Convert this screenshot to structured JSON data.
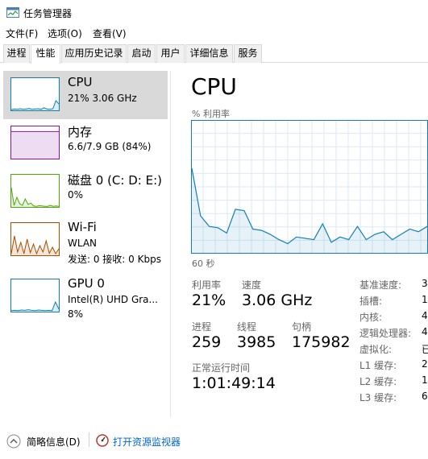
{
  "window": {
    "title": "任务管理器"
  },
  "menu": [
    "文件(F)",
    "选项(O)",
    "查看(V)"
  ],
  "tabs": [
    "进程",
    "性能",
    "应用历史记录",
    "启动",
    "用户",
    "详细信息",
    "服务"
  ],
  "active_tab": "性能",
  "resources": [
    {
      "name": "CPU",
      "line2": "21%  3.06 GHz",
      "line3": "",
      "color": "#117dbb",
      "selected": true,
      "values": [
        2,
        4,
        3,
        5,
        3,
        4,
        6,
        3,
        4,
        5,
        3,
        8,
        4,
        3,
        5,
        30,
        20
      ]
    },
    {
      "name": "内存",
      "line2": "6.6/7.9 GB (84%)",
      "line3": "",
      "color": "#8b12ae",
      "selected": false,
      "values": [
        84,
        84,
        84,
        84,
        84,
        84,
        84,
        84,
        84,
        84,
        84
      ]
    },
    {
      "name": "磁盘 0 (C: D: E:)",
      "line2": "0%",
      "line3": "",
      "color": "#4da60c",
      "selected": false,
      "values": [
        60,
        5,
        30,
        10,
        5,
        25,
        8,
        12,
        3,
        2,
        4,
        3,
        2,
        2,
        5,
        2,
        3,
        2
      ]
    },
    {
      "name": "Wi-Fi",
      "line2": "WLAN",
      "line3": "发送: 0 接收: 0 Kbps",
      "color": "#a74f01",
      "selected": false,
      "values": [
        5,
        60,
        10,
        40,
        5,
        50,
        8,
        35,
        5,
        30,
        10,
        45,
        6,
        25,
        5,
        20
      ]
    },
    {
      "name": "GPU 0",
      "line2": "Intel(R) UHD Gra...",
      "line3": "8%",
      "color": "#117dbb",
      "selected": false,
      "values": [
        3,
        4,
        3,
        5,
        4,
        6,
        4,
        3,
        5,
        4,
        3,
        4,
        3,
        30,
        8
      ]
    }
  ],
  "main": {
    "title": "CPU",
    "chart_label": "% 利用率",
    "time_label": "60 秒",
    "cpu_history": [
      64,
      28,
      20,
      19,
      15,
      33,
      32,
      18,
      17,
      14,
      10,
      7,
      12,
      11,
      10,
      22,
      8,
      12,
      10,
      20,
      10,
      14,
      16,
      10,
      14,
      18,
      16,
      20
    ]
  },
  "stats": {
    "util_label": "利用率",
    "util_value": "21%",
    "speed_label": "速度",
    "speed_value": "3.06 GHz",
    "proc_label": "进程",
    "proc_value": "259",
    "thread_label": "线程",
    "thread_value": "3985",
    "handle_label": "句柄",
    "handle_value": "175982",
    "uptime_label": "正常运行时间",
    "uptime_value": "1:01:49:14"
  },
  "specs": [
    {
      "label": "基准速度:",
      "value": "3"
    },
    {
      "label": "插槽:",
      "value": "1"
    },
    {
      "label": "内核:",
      "value": "4"
    },
    {
      "label": "逻辑处理器:",
      "value": "4"
    },
    {
      "label": "虚拟化:",
      "value": "已"
    },
    {
      "label": "L1 缓存:",
      "value": "2"
    },
    {
      "label": "L2 缓存:",
      "value": "1"
    },
    {
      "label": "L3 缓存:",
      "value": "6"
    }
  ],
  "footer": {
    "summary_label": "简略信息(D)",
    "monitor_label": "打开资源监视器"
  }
}
